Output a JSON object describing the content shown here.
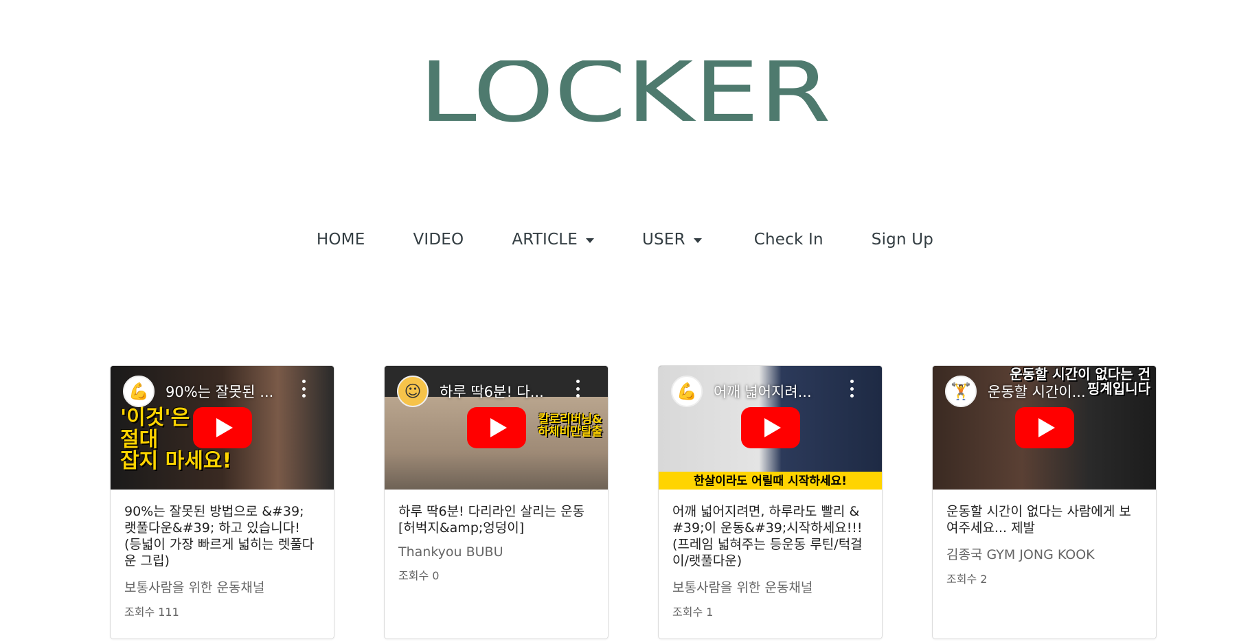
{
  "brand": {
    "logo_text": "LOCKER",
    "color": "#4e7a6e"
  },
  "nav": {
    "items": [
      {
        "label": "HOME"
      },
      {
        "label": "VIDEO"
      },
      {
        "label": "ARTICLE",
        "dropdown": true
      },
      {
        "label": "USER",
        "dropdown": true
      },
      {
        "label": "Check In"
      },
      {
        "label": "Sign Up"
      }
    ]
  },
  "videos": [
    {
      "overlay_title": "90%는 잘못된 ...",
      "thumb_text": "'이것'은\n절대\n잡지 마세요!",
      "title": "90%는 잘못된 방법으로 &#39; 랫풀다운&#39; 하고 있습니다! (등넓이 가장 빠르게 넓히는 렛풀다운 그립)",
      "channel": "보통사람을 위한 운동채널",
      "views": "조회수 111"
    },
    {
      "overlay_title": "하루 딱6분! 다...",
      "thumb_text": "칼로리버닝&\n하체비만탈출",
      "title": "하루 딱6분! 다리라인 살리는 운동 [허벅지&amp;엉덩이]",
      "channel": "Thankyou BUBU",
      "views": "조회수 0"
    },
    {
      "overlay_title": "어깨 넓어지려...",
      "thumb_text": "한살이라도 어릴때 시작하세요!",
      "title": "어깨 넓어지려면, 하루라도 빨리 &#39;이 운동&#39;시작하세요!!! (프레임 넓혀주는 등운동 루틴/턱걸이/랫풀다운)",
      "channel": "보통사람을 위한 운동채널",
      "views": "조회수 1"
    },
    {
      "overlay_title": "운동할 시간이...",
      "thumb_text": "운동할 시간이 없다는 건\n핑계입니다",
      "title": "운동할 시간이 없다는 사람에게 보여주세요... 제발",
      "channel": "김종국 GYM JONG KOOK",
      "views": "조회수 2"
    }
  ]
}
